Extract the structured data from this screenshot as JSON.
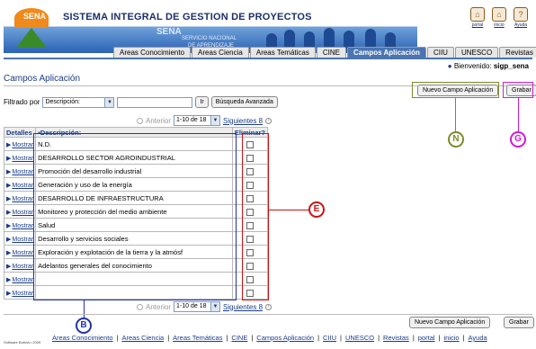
{
  "header": {
    "system_title": "SISTEMA INTEGRAL DE GESTION DE PROYECTOS",
    "org_name": "SENA",
    "org_sub1": "SERVICIO NACIONAL",
    "org_sub2": "DE APRENDIZAJE",
    "logo_text": "SENA",
    "top_links": [
      {
        "label": "portal",
        "icon": "home-icon"
      },
      {
        "label": "inicio",
        "icon": "house-icon"
      },
      {
        "label": "Ayuda",
        "icon": "help-icon"
      }
    ]
  },
  "tabs": [
    {
      "label": "Areas Conocimiento",
      "active": false
    },
    {
      "label": "Areas Ciencia",
      "active": false
    },
    {
      "label": "Areas Temáticas",
      "active": false
    },
    {
      "label": "CINE",
      "active": false
    },
    {
      "label": "Campos Aplicación",
      "active": true
    },
    {
      "label": "CIIU",
      "active": false
    },
    {
      "label": "UNESCO",
      "active": false
    },
    {
      "label": "Revistas",
      "active": false
    }
  ],
  "welcome": {
    "label": "Bienvenido:",
    "user": "sigp_sena"
  },
  "page_title": "Campos Aplicación",
  "actions": {
    "new_label": "Nuevo Campo Aplicación",
    "save_label": "Grabar"
  },
  "filter": {
    "label": "Filtrado por",
    "field_value": "Descripción:",
    "text_value": "",
    "go_label": "Ir",
    "advanced_label": "Búsqueda Avanzada"
  },
  "pager": {
    "prev_label": "Anterior",
    "range_value": "1-10 de 18",
    "next_label": "Siguientes 8"
  },
  "table": {
    "headers": {
      "details": "Detalles",
      "description": "▪Descripción:",
      "delete": "Eliminar?"
    },
    "detail_link": "Mostrar",
    "rows": [
      "N.D.",
      "DESARROLLO SECTOR AGROINDUSTRIAL",
      "Promoción del desarrollo industrial",
      "Generación y uso de la energía",
      "DESARROLLO DE INFRAESTRUCTURA",
      "Monitoreo y protección del medio ambiente",
      "Salud",
      "Desarrollo y servicios sociales",
      "Exploración y explotación de la tierra y la atmósf",
      "Adelantos generales del conocimiento",
      "",
      ""
    ]
  },
  "callouts": [
    {
      "letter": "N",
      "color": "#7f8a2a"
    },
    {
      "letter": "G",
      "color": "#d21ad2"
    },
    {
      "letter": "E",
      "color": "#cc1111"
    },
    {
      "letter": "B",
      "color": "#2233aa"
    }
  ],
  "footer": {
    "copyright": "Software Bolivia • 2009",
    "links": [
      "Areas Conocimiento",
      "Areas Ciencia",
      "Areas Temáticas",
      "CINE",
      "Campos Aplicación",
      "CIIU",
      "UNESCO",
      "Revistas",
      "portal",
      "inicio",
      "Ayuda"
    ]
  }
}
